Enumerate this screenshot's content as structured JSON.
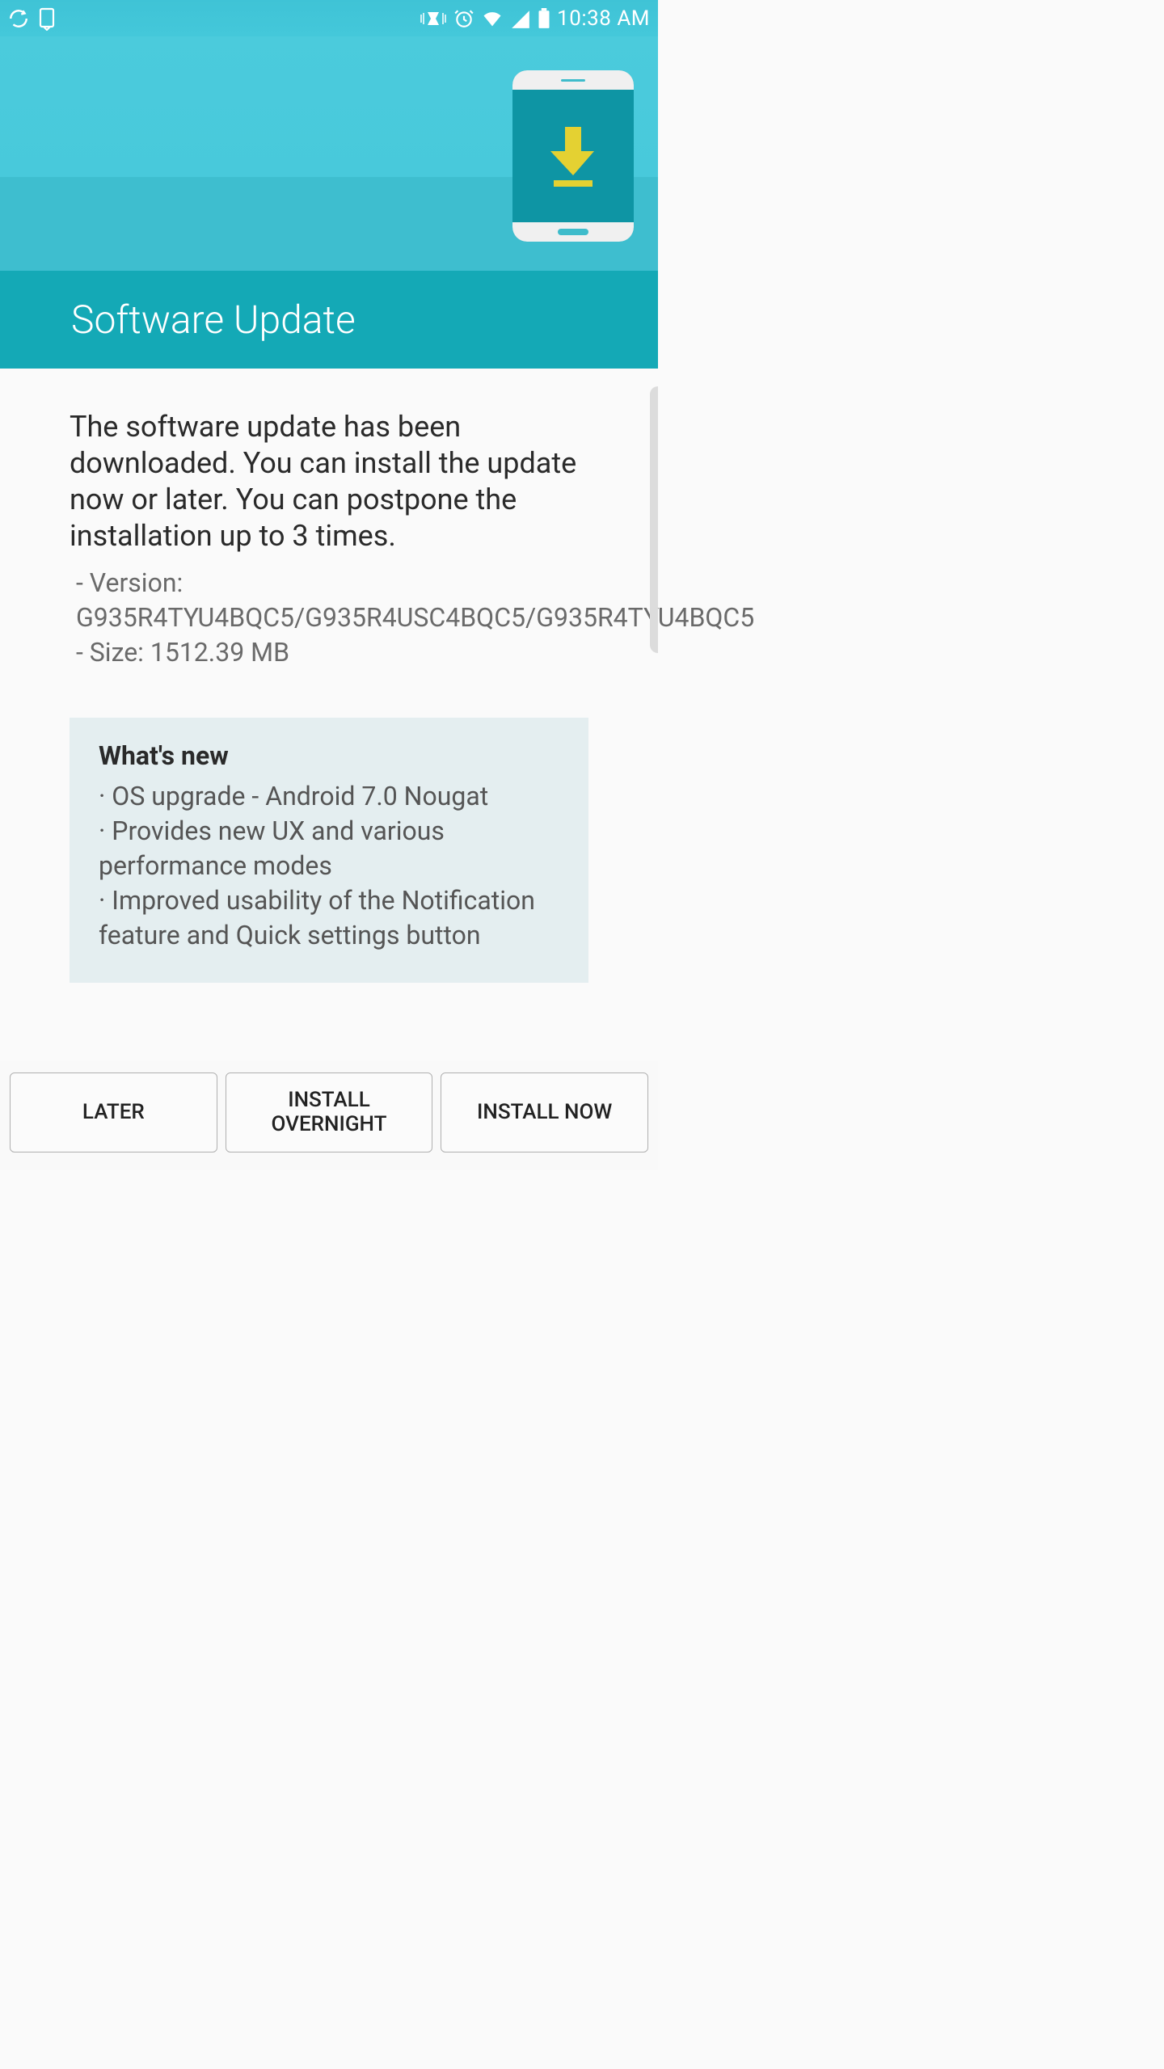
{
  "statusbar": {
    "time": "10:38 AM"
  },
  "header": {
    "title": "Software Update"
  },
  "main": {
    "intro": "The software update has been downloaded. You can install the update now or later. You can postpone the installation up to 3 times.",
    "version_line": " - Version: G935R4TYU4BQC5/G935R4USC4BQC5/G935R4TYU4BQC5",
    "size_line": " - Size: 1512.39 MB"
  },
  "whatsnew": {
    "title": "What's new",
    "items": [
      "· OS upgrade - Android 7.0 Nougat",
      "· Provides new UX and various performance modes",
      "· Improved usability of the Notification feature and Quick settings button"
    ]
  },
  "buttons": {
    "later": "LATER",
    "overnight": "INSTALL OVERNIGHT",
    "now": "INSTALL NOW"
  }
}
